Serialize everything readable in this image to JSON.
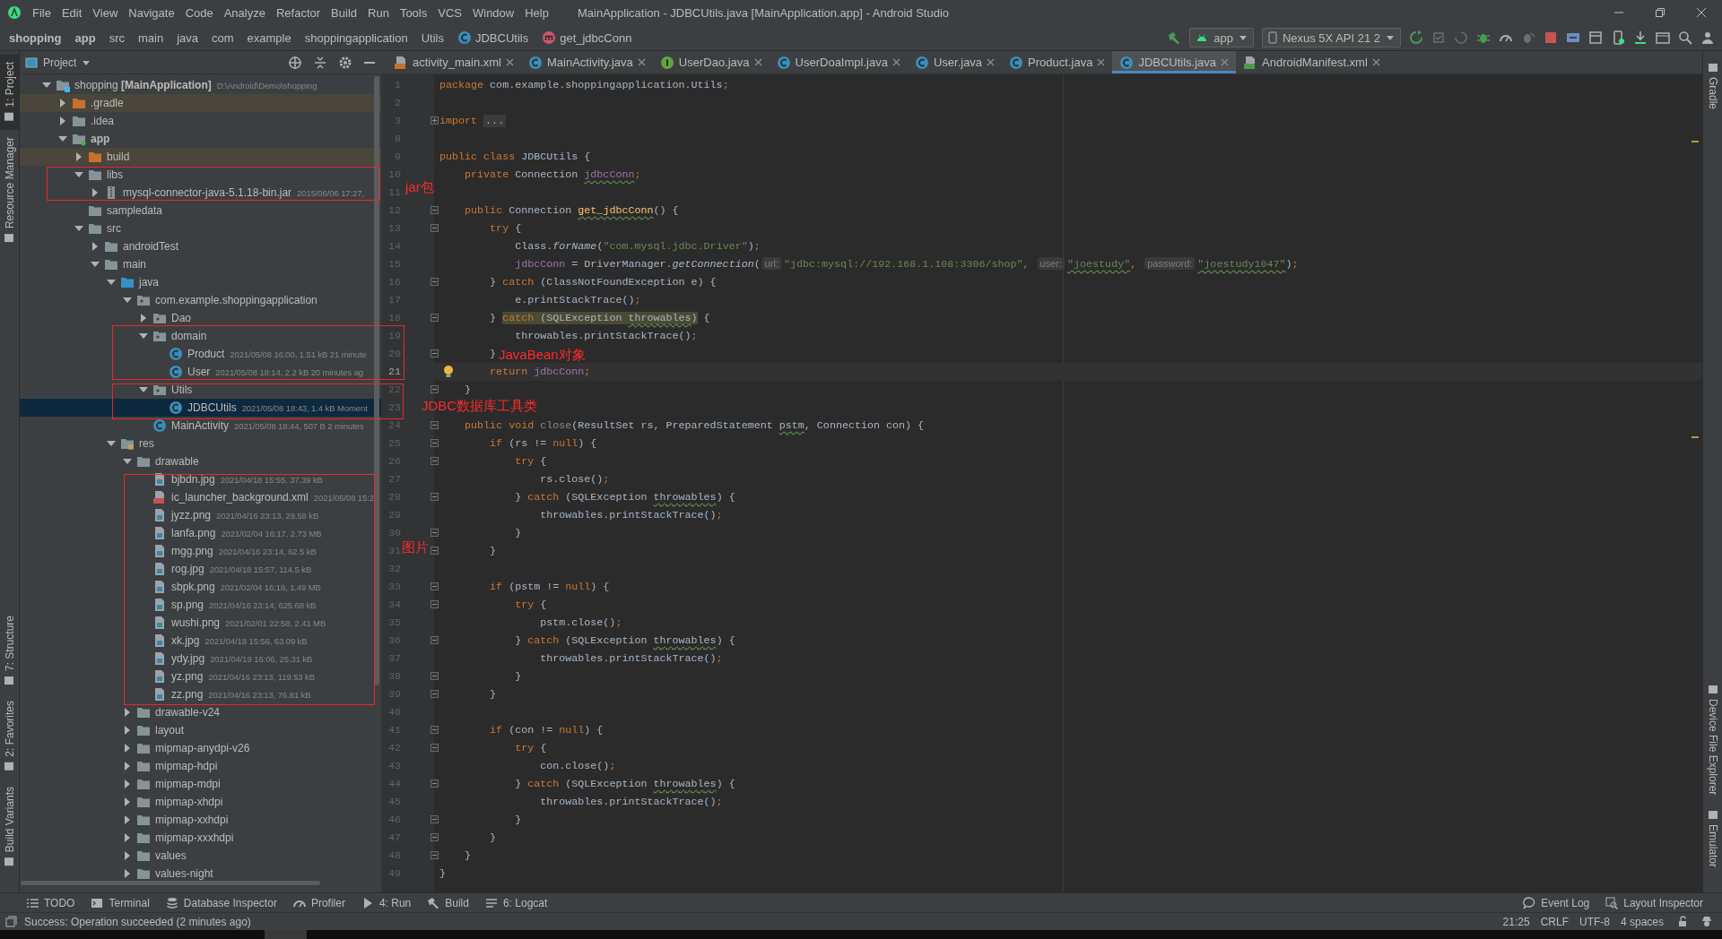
{
  "menu_bar": {
    "items": [
      "File",
      "Edit",
      "View",
      "Navigate",
      "Code",
      "Analyze",
      "Refactor",
      "Build",
      "Run",
      "Tools",
      "VCS",
      "Window",
      "Help"
    ],
    "title": "MainApplication - JDBCUtils.java [MainApplication.app] - Android Studio"
  },
  "nav_bar": {
    "breadcrumbs": [
      {
        "label": "shopping",
        "kind": "project"
      },
      {
        "label": "app",
        "kind": "module"
      },
      {
        "label": "src",
        "kind": "folder"
      },
      {
        "label": "main",
        "kind": "folder"
      },
      {
        "label": "java",
        "kind": "folder"
      },
      {
        "label": "com",
        "kind": "folder"
      },
      {
        "label": "example",
        "kind": "folder"
      },
      {
        "label": "shoppingapplication",
        "kind": "folder"
      },
      {
        "label": "Utils",
        "kind": "folder"
      },
      {
        "label": "JDBCUtils",
        "kind": "class"
      },
      {
        "label": "get_jdbcConn",
        "kind": "method"
      }
    ],
    "run_config": "app",
    "device": "Nexus 5X API 21 2"
  },
  "side_tools": {
    "left_top": [
      {
        "label": "1: Project",
        "selected": true
      },
      {
        "label": "Resource Manager",
        "selected": false
      }
    ],
    "left_bottom": [
      {
        "label": "7: Structure",
        "selected": false
      },
      {
        "label": "2: Favorites",
        "selected": false
      },
      {
        "label": "Build Variants",
        "selected": false
      }
    ],
    "right_top": [
      {
        "label": "Gradle",
        "selected": false
      }
    ],
    "right_bottom": [
      {
        "label": "Device File Explorer",
        "selected": false
      },
      {
        "label": "Emulator",
        "selected": false
      }
    ]
  },
  "project": {
    "title": "Project",
    "tree": [
      {
        "name": "shopping **[MainApplication]**",
        "meta": "D:\\Android\\Demo\\shopping",
        "kind": "project",
        "expanded": true,
        "selected": false,
        "children": [
          {
            "name": ".gradle",
            "kind": "excluded-folder",
            "expanded": false,
            "selected": false
          },
          {
            "name": ".idea",
            "kind": "folder",
            "expanded": false,
            "selected": false
          },
          {
            "name": "app",
            "kind": "module",
            "expanded": true,
            "selected": false,
            "children": [
              {
                "name": "build",
                "kind": "excluded-folder",
                "expanded": false,
                "selected": false
              },
              {
                "name": "libs",
                "kind": "folder",
                "expanded": true,
                "selected": false,
                "children": [
                  {
                    "name": "mysql-connector-java-5.1.18-bin.jar",
                    "meta": "2015/06/06 17:27,",
                    "kind": "jar",
                    "expanded": false,
                    "selected": false
                  }
                ]
              },
              {
                "name": "sampledata",
                "kind": "folder",
                "selected": false
              },
              {
                "name": "src",
                "kind": "folder",
                "expanded": true,
                "selected": false,
                "children": [
                  {
                    "name": "androidTest",
                    "kind": "folder",
                    "expanded": false,
                    "selected": false
                  },
                  {
                    "name": "main",
                    "kind": "folder",
                    "expanded": true,
                    "selected": false,
                    "children": [
                      {
                        "name": "java",
                        "kind": "source-folder",
                        "expanded": true,
                        "selected": false,
                        "children": [
                          {
                            "name": "com.example.shoppingapplication",
                            "kind": "package",
                            "expanded": true,
                            "selected": false,
                            "children": [
                              {
                                "name": "Dao",
                                "kind": "package",
                                "expanded": false,
                                "selected": false
                              },
                              {
                                "name": "domain",
                                "kind": "package",
                                "expanded": true,
                                "selected": false,
                                "children": [
                                  {
                                    "name": "Product",
                                    "meta": "2021/05/08 16:00, 1.51 kB  21 minute",
                                    "kind": "class",
                                    "selected": false
                                  },
                                  {
                                    "name": "User",
                                    "meta": "2021/05/08 18:14, 2.2 kB  20 minutes ag",
                                    "kind": "class",
                                    "selected": false
                                  }
                                ]
                              },
                              {
                                "name": "Utils",
                                "kind": "package",
                                "expanded": true,
                                "selected": false,
                                "children": [
                                  {
                                    "name": "JDBCUtils",
                                    "meta": "2021/05/08 18:43, 1.4 kB  Moment",
                                    "kind": "class",
                                    "selected": true
                                  }
                                ]
                              },
                              {
                                "name": "MainActivity",
                                "meta": "2021/05/08 18:44, 507 B  2 minutes",
                                "kind": "class",
                                "selected": false
                              }
                            ]
                          }
                        ]
                      },
                      {
                        "name": "res",
                        "kind": "resources-folder",
                        "expanded": true,
                        "selected": false,
                        "children": [
                          {
                            "name": "drawable",
                            "kind": "folder",
                            "expanded": true,
                            "selected": false,
                            "children": [
                              {
                                "name": "bjbdn.jpg",
                                "meta": "2021/04/18 15:55, 37.39 kB",
                                "kind": "image",
                                "selected": false
                              },
                              {
                                "name": "ic_launcher_background.xml",
                                "meta": "2021/05/08 15:2",
                                "kind": "xml",
                                "selected": false
                              },
                              {
                                "name": "jyzz.png",
                                "meta": "2021/04/16 23:13, 29.59 kB",
                                "kind": "image",
                                "selected": false
                              },
                              {
                                "name": "lanfa.png",
                                "meta": "2021/02/04 16:17, 2.73 MB",
                                "kind": "image",
                                "selected": false
                              },
                              {
                                "name": "mgg.png",
                                "meta": "2021/04/16 23:14, 62.5 kB",
                                "kind": "image",
                                "selected": false
                              },
                              {
                                "name": "rog.jpg",
                                "meta": "2021/04/18 15:57, 114.5 kB",
                                "kind": "image",
                                "selected": false
                              },
                              {
                                "name": "sbpk.png",
                                "meta": "2021/02/04 16:18, 1.49 MB",
                                "kind": "image",
                                "selected": false
                              },
                              {
                                "name": "sp.png",
                                "meta": "2021/04/16 23:14, 625.68 kB",
                                "kind": "image",
                                "selected": false
                              },
                              {
                                "name": "wushi.png",
                                "meta": "2021/02/01 22:58, 2.41 MB",
                                "kind": "image",
                                "selected": false
                              },
                              {
                                "name": "xk.jpg",
                                "meta": "2021/04/18 15:56, 63.09 kB",
                                "kind": "image",
                                "selected": false
                              },
                              {
                                "name": "ydy.jpg",
                                "meta": "2021/04/19 16:06, 25.31 kB",
                                "kind": "image",
                                "selected": false
                              },
                              {
                                "name": "yz.png",
                                "meta": "2021/04/16 23:13, 119.53 kB",
                                "kind": "image",
                                "selected": false
                              },
                              {
                                "name": "zz.png",
                                "meta": "2021/04/16 23:13, 76.81 kB",
                                "kind": "image",
                                "selected": false
                              }
                            ]
                          },
                          {
                            "name": "drawable-v24",
                            "kind": "folder",
                            "expanded": false,
                            "selected": false
                          },
                          {
                            "name": "layout",
                            "kind": "folder",
                            "expanded": false,
                            "selected": false
                          },
                          {
                            "name": "mipmap-anydpi-v26",
                            "kind": "folder",
                            "expanded": false,
                            "selected": false
                          },
                          {
                            "name": "mipmap-hdpi",
                            "kind": "folder",
                            "expanded": false,
                            "selected": false
                          },
                          {
                            "name": "mipmap-mdpi",
                            "kind": "folder",
                            "expanded": false,
                            "selected": false
                          },
                          {
                            "name": "mipmap-xhdpi",
                            "kind": "folder",
                            "expanded": false,
                            "selected": false
                          },
                          {
                            "name": "mipmap-xxhdpi",
                            "kind": "folder",
                            "expanded": false,
                            "selected": false
                          },
                          {
                            "name": "mipmap-xxxhdpi",
                            "kind": "folder",
                            "expanded": false,
                            "selected": false
                          },
                          {
                            "name": "values",
                            "kind": "folder",
                            "expanded": false,
                            "selected": false
                          },
                          {
                            "name": "values-night",
                            "kind": "folder",
                            "expanded": false,
                            "selected": false
                          }
                        ]
                      }
                    ]
                  }
                ]
              }
            ]
          }
        ]
      }
    ]
  },
  "editor": {
    "tabs": [
      {
        "label": "activity_main.xml",
        "kind": "layout",
        "selected": false
      },
      {
        "label": "MainActivity.java",
        "kind": "class",
        "selected": false
      },
      {
        "label": "UserDao.java",
        "kind": "interface",
        "selected": false
      },
      {
        "label": "UserDoaImpl.java",
        "kind": "class",
        "selected": false
      },
      {
        "label": "User.java",
        "kind": "class",
        "selected": false
      },
      {
        "label": "Product.java",
        "kind": "class",
        "selected": false
      },
      {
        "label": "JDBCUtils.java",
        "kind": "class",
        "selected": true
      },
      {
        "label": "AndroidManifest.xml",
        "kind": "manifest",
        "selected": false
      }
    ],
    "lines": [
      {
        "number": "1",
        "current": false,
        "segments": [
          {
            "text": "package ",
            "kind": "keyword"
          },
          {
            "text": "com.example.shoppingapplication.Utils",
            "kind": "plain"
          },
          {
            "text": ";",
            "kind": "keyword"
          }
        ]
      },
      {
        "number": "2",
        "current": false
      },
      {
        "number": "3",
        "current": false,
        "fold": {
          "collapsed": true
        },
        "segments": [
          {
            "text": "import ",
            "kind": "keyword"
          },
          {
            "text": "...",
            "kind": "folded"
          }
        ]
      },
      {
        "number": "8",
        "current": false
      },
      {
        "number": "9",
        "current": false,
        "segments": [
          {
            "text": "public class ",
            "kind": "keyword"
          },
          {
            "text": "JDBCUtils {",
            "kind": "plain"
          }
        ]
      },
      {
        "number": "10",
        "current": false,
        "segments": [
          {
            "text": "    private ",
            "kind": "keyword"
          },
          {
            "text": "Connection ",
            "kind": "plain"
          },
          {
            "text": "jdbcConn",
            "kind": "field-typo"
          },
          {
            "text": ";",
            "kind": "keyword"
          }
        ]
      },
      {
        "number": "11",
        "current": false
      },
      {
        "number": "12",
        "current": false,
        "fold": {
          "collapsed": false
        },
        "segments": [
          {
            "text": "    public ",
            "kind": "keyword"
          },
          {
            "text": "Connection ",
            "kind": "plain"
          },
          {
            "text": "get_jdbcConn",
            "kind": "method-typo"
          },
          {
            "text": "() {",
            "kind": "plain"
          }
        ]
      },
      {
        "number": "13",
        "current": false,
        "fold": {
          "collapsed": false
        },
        "segments": [
          {
            "text": "        try ",
            "kind": "keyword"
          },
          {
            "text": "{",
            "kind": "plain"
          }
        ]
      },
      {
        "number": "14",
        "current": false,
        "segments": [
          {
            "text": "            Class.",
            "kind": "plain"
          },
          {
            "text": "forName",
            "kind": "italic"
          },
          {
            "text": "(",
            "kind": "plain"
          },
          {
            "text": "\"com.mysql.jdbc.Driver\"",
            "kind": "string"
          },
          {
            "text": ")",
            "kind": "plain"
          },
          {
            "text": ";",
            "kind": "keyword"
          }
        ]
      },
      {
        "number": "15",
        "current": false,
        "segments": [
          {
            "text": "            jdbcConn",
            "kind": "field"
          },
          {
            "text": " = DriverManager.",
            "kind": "plain"
          },
          {
            "text": "getConnection",
            "kind": "italic"
          },
          {
            "text": "(",
            "kind": "plain"
          },
          {
            "text": "url:",
            "kind": "hint"
          },
          {
            "text": "\"jdbc:mysql://192.168.1.108:3306/shop\"",
            "kind": "string"
          },
          {
            "text": ", ",
            "kind": "keyword"
          },
          {
            "text": "user:",
            "kind": "hint"
          },
          {
            "text": "\"joestudy\"",
            "kind": "string-typo"
          },
          {
            "text": ", ",
            "kind": "keyword"
          },
          {
            "text": "password:",
            "kind": "hint"
          },
          {
            "text": "\"joestudy1047\"",
            "kind": "string-typo"
          },
          {
            "text": ")",
            "kind": "plain"
          },
          {
            "text": ";",
            "kind": "keyword"
          }
        ]
      },
      {
        "number": "16",
        "current": false,
        "fold": {
          "collapsed": false
        },
        "segments": [
          {
            "text": "        } ",
            "kind": "plain"
          },
          {
            "text": "catch ",
            "kind": "keyword"
          },
          {
            "text": "(ClassNotFoundException e) {",
            "kind": "plain"
          }
        ]
      },
      {
        "number": "17",
        "current": false,
        "segments": [
          {
            "text": "            e.printStackTrace()",
            "kind": "plain"
          },
          {
            "text": ";",
            "kind": "keyword"
          }
        ]
      },
      {
        "number": "18",
        "current": false,
        "fold": {
          "collapsed": false
        },
        "segments": [
          {
            "text": "        } ",
            "kind": "plain"
          },
          {
            "text": "catch ",
            "kind": "keyword-highlight"
          },
          {
            "text": "(SQLException ",
            "kind": "highlight"
          },
          {
            "text": "throwables",
            "kind": "highlight-typo"
          },
          {
            "text": ")",
            "kind": "highlight"
          },
          {
            "text": " {",
            "kind": "plain"
          }
        ]
      },
      {
        "number": "19",
        "current": false,
        "segments": [
          {
            "text": "            throwables.printStackTrace()",
            "kind": "plain"
          },
          {
            "text": ";",
            "kind": "keyword"
          }
        ]
      },
      {
        "number": "20",
        "current": false,
        "fold": {
          "collapsed": false
        },
        "segments": [
          {
            "text": "        }",
            "kind": "plain"
          }
        ]
      },
      {
        "number": "21",
        "current": true,
        "segments": [
          {
            "text": "        return ",
            "kind": "keyword"
          },
          {
            "text": "jdbcConn",
            "kind": "field"
          },
          {
            "text": ";",
            "kind": "keyword"
          }
        ]
      },
      {
        "number": "22",
        "current": false,
        "fold": {
          "collapsed": false
        },
        "segments": [
          {
            "text": "    }",
            "kind": "plain"
          }
        ]
      },
      {
        "number": "23",
        "current": false
      },
      {
        "number": "24",
        "current": false,
        "fold": {
          "collapsed": false
        },
        "segments": [
          {
            "text": "    public void ",
            "kind": "keyword"
          },
          {
            "text": "close",
            "kind": "unused"
          },
          {
            "text": "(ResultSet rs, PreparedStatement ",
            "kind": "plain"
          },
          {
            "text": "pstm",
            "kind": "typo"
          },
          {
            "text": ", Connection con) {",
            "kind": "plain"
          }
        ]
      },
      {
        "number": "25",
        "current": false,
        "fold": {
          "collapsed": false
        },
        "segments": [
          {
            "text": "        if ",
            "kind": "keyword"
          },
          {
            "text": "(rs != ",
            "kind": "plain"
          },
          {
            "text": "null",
            "kind": "keyword"
          },
          {
            "text": ") {",
            "kind": "plain"
          }
        ]
      },
      {
        "number": "26",
        "current": false,
        "fold": {
          "collapsed": false
        },
        "segments": [
          {
            "text": "            try ",
            "kind": "keyword"
          },
          {
            "text": "{",
            "kind": "plain"
          }
        ]
      },
      {
        "number": "27",
        "current": false,
        "segments": [
          {
            "text": "                rs.close()",
            "kind": "plain"
          },
          {
            "text": ";",
            "kind": "keyword"
          }
        ]
      },
      {
        "number": "28",
        "current": false,
        "fold": {
          "collapsed": false
        },
        "segments": [
          {
            "text": "            } ",
            "kind": "plain"
          },
          {
            "text": "catch ",
            "kind": "keyword"
          },
          {
            "text": "(SQLException ",
            "kind": "plain"
          },
          {
            "text": "throwables",
            "kind": "typo"
          },
          {
            "text": ") {",
            "kind": "plain"
          }
        ]
      },
      {
        "number": "29",
        "current": false,
        "segments": [
          {
            "text": "                throwables.printStackTrace()",
            "kind": "plain"
          },
          {
            "text": ";",
            "kind": "keyword"
          }
        ]
      },
      {
        "number": "30",
        "current": false,
        "fold": {
          "collapsed": false
        },
        "segments": [
          {
            "text": "            }",
            "kind": "plain"
          }
        ]
      },
      {
        "number": "31",
        "current": false,
        "fold": {
          "collapsed": false
        },
        "segments": [
          {
            "text": "        }",
            "kind": "plain"
          }
        ]
      },
      {
        "number": "32",
        "current": false
      },
      {
        "number": "33",
        "current": false,
        "fold": {
          "collapsed": false
        },
        "segments": [
          {
            "text": "        if ",
            "kind": "keyword"
          },
          {
            "text": "(pstm != ",
            "kind": "plain"
          },
          {
            "text": "null",
            "kind": "keyword"
          },
          {
            "text": ") {",
            "kind": "plain"
          }
        ]
      },
      {
        "number": "34",
        "current": false,
        "fold": {
          "collapsed": false
        },
        "segments": [
          {
            "text": "            try ",
            "kind": "keyword"
          },
          {
            "text": "{",
            "kind": "plain"
          }
        ]
      },
      {
        "number": "35",
        "current": false,
        "segments": [
          {
            "text": "                pstm.close()",
            "kind": "plain"
          },
          {
            "text": ";",
            "kind": "keyword"
          }
        ]
      },
      {
        "number": "36",
        "current": false,
        "fold": {
          "collapsed": false
        },
        "segments": [
          {
            "text": "            } ",
            "kind": "plain"
          },
          {
            "text": "catch ",
            "kind": "keyword"
          },
          {
            "text": "(SQLException ",
            "kind": "plain"
          },
          {
            "text": "throwables",
            "kind": "typo"
          },
          {
            "text": ") {",
            "kind": "plain"
          }
        ]
      },
      {
        "number": "37",
        "current": false,
        "segments": [
          {
            "text": "                throwables.printStackTrace()",
            "kind": "plain"
          },
          {
            "text": ";",
            "kind": "keyword"
          }
        ]
      },
      {
        "number": "38",
        "current": false,
        "fold": {
          "collapsed": false
        },
        "segments": [
          {
            "text": "            }",
            "kind": "plain"
          }
        ]
      },
      {
        "number": "39",
        "current": false,
        "fold": {
          "collapsed": false
        },
        "segments": [
          {
            "text": "        }",
            "kind": "plain"
          }
        ]
      },
      {
        "number": "40",
        "current": false
      },
      {
        "number": "41",
        "current": false,
        "fold": {
          "collapsed": false
        },
        "segments": [
          {
            "text": "        if ",
            "kind": "keyword"
          },
          {
            "text": "(con != ",
            "kind": "plain"
          },
          {
            "text": "null",
            "kind": "keyword"
          },
          {
            "text": ") {",
            "kind": "plain"
          }
        ]
      },
      {
        "number": "42",
        "current": false,
        "fold": {
          "collapsed": false
        },
        "segments": [
          {
            "text": "            try ",
            "kind": "keyword"
          },
          {
            "text": "{",
            "kind": "plain"
          }
        ]
      },
      {
        "number": "43",
        "current": false,
        "segments": [
          {
            "text": "                con.close()",
            "kind": "plain"
          },
          {
            "text": ";",
            "kind": "keyword"
          }
        ]
      },
      {
        "number": "44",
        "current": false,
        "fold": {
          "collapsed": false
        },
        "segments": [
          {
            "text": "            } ",
            "kind": "plain"
          },
          {
            "text": "catch ",
            "kind": "keyword"
          },
          {
            "text": "(SQLException ",
            "kind": "plain"
          },
          {
            "text": "throwables",
            "kind": "typo"
          },
          {
            "text": ") {",
            "kind": "plain"
          }
        ]
      },
      {
        "number": "45",
        "current": false,
        "segments": [
          {
            "text": "                throwables.printStackTrace()",
            "kind": "plain"
          },
          {
            "text": ";",
            "kind": "keyword"
          }
        ]
      },
      {
        "number": "46",
        "current": false,
        "fold": {
          "collapsed": false
        },
        "segments": [
          {
            "text": "            }",
            "kind": "plain"
          }
        ]
      },
      {
        "number": "47",
        "current": false,
        "fold": {
          "collapsed": false
        },
        "segments": [
          {
            "text": "        }",
            "kind": "plain"
          }
        ]
      },
      {
        "number": "48",
        "current": false,
        "fold": {
          "collapsed": false
        },
        "segments": [
          {
            "text": "    }",
            "kind": "plain"
          }
        ]
      },
      {
        "number": "49",
        "current": false,
        "segments": [
          {
            "text": "}",
            "kind": "plain"
          }
        ]
      }
    ]
  },
  "annotations": [
    {
      "label": "jar包"
    },
    {
      "label": "JavaBean对象"
    },
    {
      "label": "JDBC数据库工具类"
    },
    {
      "label": "图片"
    }
  ],
  "tool_windows": {
    "left": [
      {
        "label": "TODO",
        "kind": "todo"
      },
      {
        "label": "Terminal",
        "kind": "terminal"
      },
      {
        "label": "Database Inspector",
        "kind": "database"
      },
      {
        "label": "Profiler",
        "kind": "profiler"
      },
      {
        "label": "4: Run",
        "kind": "run"
      },
      {
        "label": "Build",
        "kind": "build"
      },
      {
        "label": "6: Logcat",
        "kind": "logcat"
      }
    ],
    "right": [
      {
        "label": "Event Log",
        "kind": "event-log"
      },
      {
        "label": "Layout Inspector",
        "kind": "layout-inspector"
      }
    ]
  },
  "status_bar": {
    "message": "Success: Operation succeeded (2 minutes ago)",
    "caret": "21:25",
    "line_separator": "CRLF",
    "encoding": "UTF-8",
    "indent": "4 spaces"
  }
}
